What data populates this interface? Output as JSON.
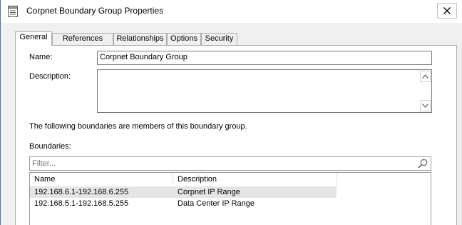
{
  "window": {
    "title": "Corpnet Boundary Group Properties"
  },
  "tabs": [
    {
      "label": "General",
      "active": true
    },
    {
      "label": "References",
      "active": false
    },
    {
      "label": "Relationships",
      "active": false
    },
    {
      "label": "Options",
      "active": false
    },
    {
      "label": "Security",
      "active": false
    }
  ],
  "general": {
    "name_label": "Name:",
    "name_value": "Corpnet Boundary Group",
    "description_label": "Description:",
    "description_value": "",
    "members_text": "The following boundaries are members of this boundary group.",
    "boundaries_label": "Boundaries:",
    "filter_placeholder": "Filter..."
  },
  "boundaries_table": {
    "columns": [
      "Name",
      "Description"
    ],
    "rows": [
      {
        "name": "192.168.6.1-192.168.6.255",
        "description": "Corpnet IP Range",
        "selected": true
      },
      {
        "name": "192.168.5.1-192.168.5.255",
        "description": "Data Center IP Range",
        "selected": false
      }
    ]
  },
  "icons": {
    "window_icon": "properties-document-icon",
    "close": "close-icon",
    "scroll_up": "chevron-up-icon",
    "scroll_down": "chevron-down-icon",
    "filter": "search-icon"
  }
}
